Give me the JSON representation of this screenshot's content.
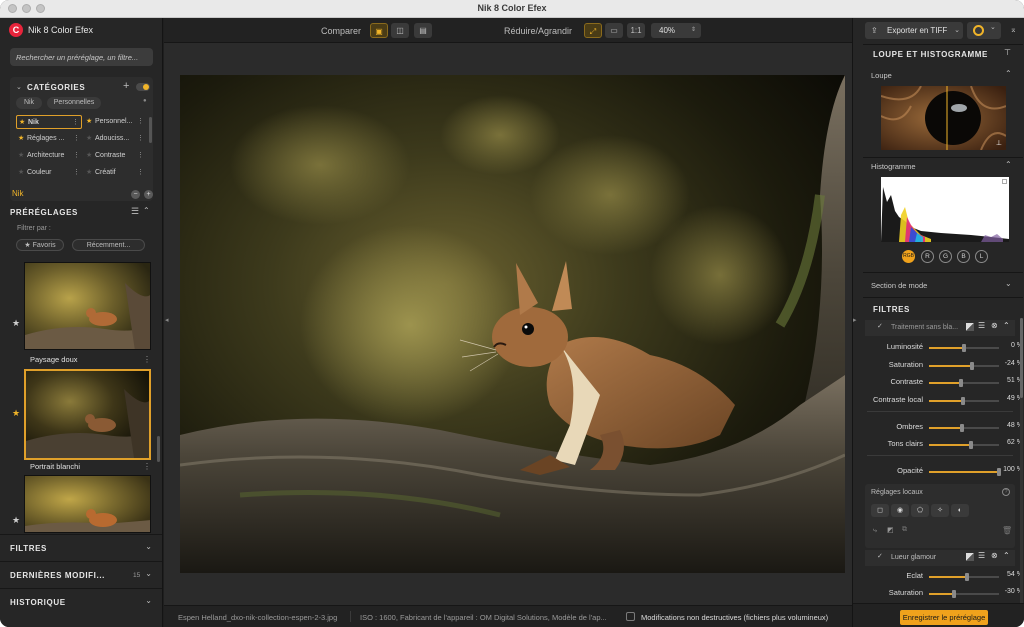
{
  "window": {
    "title": "Nik 8 Color Efex"
  },
  "app": {
    "name": "Nik 8 Color Efex"
  },
  "search": {
    "placeholder": "Rechercher un préréglage, un filtre..."
  },
  "categories": {
    "title": "CATÉGORIES",
    "tags": [
      "Nik",
      "Personnelles"
    ],
    "items": [
      {
        "label": "Nik",
        "starred": true,
        "selected": true
      },
      {
        "label": "Personnel...",
        "starred": true,
        "selected": false
      },
      {
        "label": "Réglages ...",
        "starred": true,
        "selected": false
      },
      {
        "label": "Adouciss...",
        "starred": false,
        "selected": false
      },
      {
        "label": "Architecture",
        "starred": false,
        "selected": false
      },
      {
        "label": "Contraste",
        "starred": false,
        "selected": false
      },
      {
        "label": "Couleur",
        "starred": false,
        "selected": false
      },
      {
        "label": "Créatif",
        "starred": false,
        "selected": false
      }
    ],
    "current": "Nik"
  },
  "presets": {
    "title": "PRÉRÉGLAGES",
    "filter_label": "Filtrer par :",
    "filters": [
      "★ Favoris",
      "Récemment..."
    ],
    "items": [
      {
        "label": "Paysage doux",
        "favorite": false
      },
      {
        "label": "Portrait blanchi",
        "favorite": true
      }
    ]
  },
  "left_sections": [
    {
      "title": "FILTRES"
    },
    {
      "title": "DERNIÈRES MODIFI...",
      "count": "15"
    },
    {
      "title": "HISTORIQUE"
    }
  ],
  "toolbar": {
    "compare_label": "Comparer",
    "zoom_label": "Réduire/Agrandir",
    "zoom_1to1": "1:1",
    "zoom_value": "40%"
  },
  "statusbar": {
    "filename": "Espen Helland_dxo-nik-collection-espen-2-3.jpg",
    "meta": "ISO : 1600, Fabricant de l'appareil : OM Digital Solutions, Modèle de l'ap...",
    "non_destructive": "Modifications non destructives (fichiers plus volumineux)"
  },
  "right": {
    "export_label": "Exporter en TIFF",
    "loupe_section": "LOUPE ET HISTOGRAMME",
    "loupe_label": "Loupe",
    "histogram_label": "Histogramme",
    "channels": [
      "RGB",
      "R",
      "G",
      "B",
      "L"
    ],
    "mode_section": "Section de mode",
    "filters_title": "FILTRES",
    "filter1": {
      "name": "Traitement sans bla...",
      "sliders": [
        {
          "label": "Luminosité",
          "value": "0 %",
          "fraction": 0.5
        },
        {
          "label": "Saturation",
          "value": "-24 %",
          "fraction": 0.62
        },
        {
          "label": "Contraste",
          "value": "51 %",
          "fraction": 0.45
        },
        {
          "label": "Contraste local",
          "value": "49 %",
          "fraction": 0.48
        },
        {
          "label": "Ombres",
          "value": "48 %",
          "fraction": 0.47
        },
        {
          "label": "Tons clairs",
          "value": "62 %",
          "fraction": 0.6
        },
        {
          "label": "Opacité",
          "value": "100 %",
          "fraction": 1.0
        }
      ]
    },
    "local_adjust": "Réglages locaux",
    "filter2": {
      "name": "Lueur glamour",
      "sliders": [
        {
          "label": "Eclat",
          "value": "54 %",
          "fraction": 0.54
        },
        {
          "label": "Saturation",
          "value": "-30 %",
          "fraction": 0.35
        }
      ]
    },
    "save_preset": "Enregistrer le préréglage"
  },
  "colors": {
    "accent": "#e0a02a",
    "logo": "#e8243b"
  }
}
